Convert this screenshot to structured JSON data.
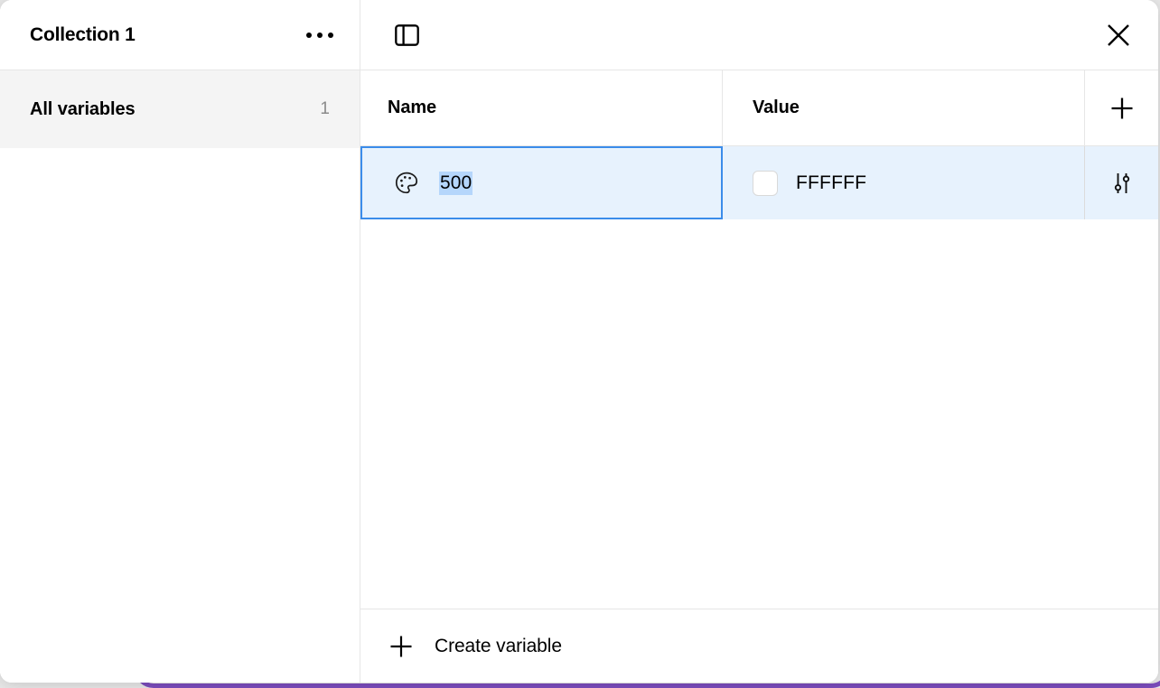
{
  "window": {
    "accent_purple": "#7c4dbe",
    "selection_blue": "#3b8cea",
    "row_highlight": "#e7f2fd",
    "text_selection": "#b5d6fb"
  },
  "sidebar": {
    "title": "Collection 1",
    "menu_icon": "more-horizontal-icon",
    "items": [
      {
        "label": "All variables",
        "count": "1",
        "selected": true
      }
    ]
  },
  "toolbar": {
    "panel_toggle_icon": "sidebar-panel-icon",
    "close_icon": "close-icon"
  },
  "table": {
    "columns": [
      {
        "key": "name",
        "label": "Name"
      },
      {
        "key": "value",
        "label": "Value"
      }
    ],
    "add_icon": "plus-icon",
    "rows": [
      {
        "type_icon": "color-palette-icon",
        "name": "500",
        "name_selected": true,
        "swatch_color": "#ffffff",
        "value": "FFFFFF",
        "actions_icon": "sliders-icon"
      }
    ]
  },
  "footer": {
    "create_icon": "plus-icon",
    "create_label": "Create variable"
  }
}
